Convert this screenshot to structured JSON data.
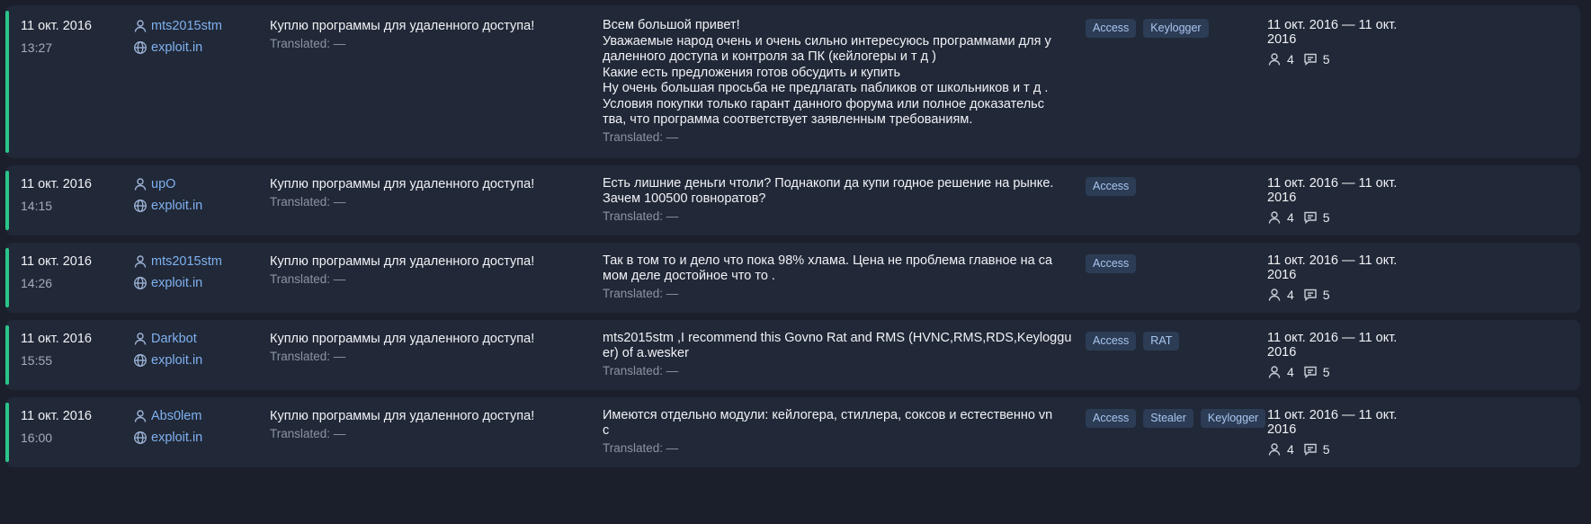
{
  "colors": {
    "accent": "#2bc48a",
    "row_bg": "#212837",
    "page_bg": "#1a1f2b",
    "link": "#7fb1f0",
    "tag_bg": "#2c3c55"
  },
  "rows": [
    {
      "date": "11 окт. 2016",
      "time": "13:27",
      "author": "mts2015stm",
      "forum": "exploit.in",
      "title": "Куплю программы для удаленного доступа!",
      "title_translated": "Translated: —",
      "body": "Всем большой привет!\nУважаемые народ очень и очень сильно интересуюсь программами для у\nдаленного доступа и контроля за ПК (кейлогеры и т д )\nКакие есть предложения готов обсудить и купить\nНу очень большая просьба не предлагать пабликов от школьников и т д .\nУсловия покупки только гарант данного форума или полное доказательс\nтва, что программа соответствует  заявленным требованиям.",
      "body_translated": "Translated: —",
      "tags": [
        "Access",
        "Keylogger"
      ],
      "range": "11 окт. 2016 — 11 окт. 2016",
      "users": "4",
      "messages": "5"
    },
    {
      "date": "11 окт. 2016",
      "time": "14:15",
      "author": "upO",
      "forum": "exploit.in",
      "title": "Куплю программы для удаленного доступа!",
      "title_translated": "Translated: —",
      "body": "Есть лишние деньги чтоли? Поднакопи да купи годное решение на рынке.\nЗачем 100500 говноратов?",
      "body_translated": "Translated: —",
      "tags": [
        "Access"
      ],
      "range": "11 окт. 2016 — 11 окт. 2016",
      "users": "4",
      "messages": "5"
    },
    {
      "date": "11 окт. 2016",
      "time": "14:26",
      "author": "mts2015stm",
      "forum": "exploit.in",
      "title": "Куплю программы для удаленного доступа!",
      "title_translated": "Translated: —",
      "body": "Так в том то и дело что пока 98% хлама. Цена не проблема главное на са\nмом деле достойное что то .",
      "body_translated": "Translated: —",
      "tags": [
        "Access"
      ],
      "range": "11 окт. 2016 — 11 окт. 2016",
      "users": "4",
      "messages": "5"
    },
    {
      "date": "11 окт. 2016",
      "time": "15:55",
      "author": "Darkbot",
      "forum": "exploit.in",
      "title": "Куплю программы для удаленного доступа!",
      "title_translated": "Translated: —",
      "body": "mts2015stm ,I recommend this Govno Rat and RMS (HVNC,RMS,RDS,Keyloggu\ner) of a.wesker",
      "body_translated": "Translated: —",
      "tags": [
        "Access",
        "RAT"
      ],
      "range": "11 окт. 2016 — 11 окт. 2016",
      "users": "4",
      "messages": "5"
    },
    {
      "date": "11 окт. 2016",
      "time": "16:00",
      "author": "Abs0lem",
      "forum": "exploit.in",
      "title": "Куплю программы для удаленного доступа!",
      "title_translated": "Translated: —",
      "body": "Имеются отдельно модули: кейлогера, стиллера, соксов и естественно vn\nc",
      "body_translated": "Translated: —",
      "tags": [
        "Access",
        "Stealer",
        "Keylogger"
      ],
      "range": "11 окт. 2016 — 11 окт. 2016",
      "users": "4",
      "messages": "5"
    }
  ],
  "icons": {
    "author": "user-icon",
    "forum": "globe-icon",
    "users": "users-icon",
    "messages": "message-icon"
  }
}
